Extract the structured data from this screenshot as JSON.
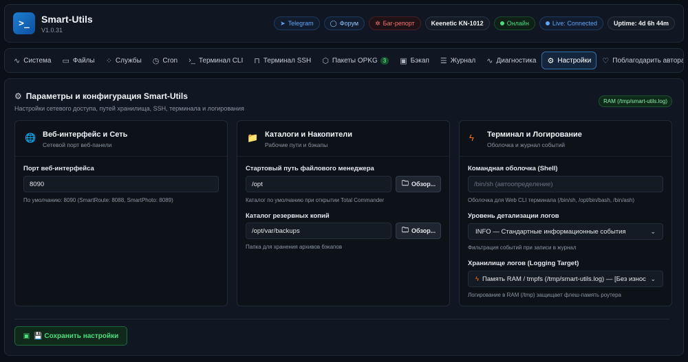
{
  "app": {
    "logo": ">_",
    "title": "Smart-Utils",
    "version": "V1.0.31"
  },
  "header_badges": {
    "telegram": "Telegram",
    "forum": "Форум",
    "bug": "Баг-репорт",
    "device": "Keenetic KN-1012",
    "online": "Онлайн",
    "live": "Live: Connected",
    "uptime": "Uptime: 4d 6h 44m"
  },
  "tabs": [
    {
      "label": "Система",
      "icon": "pulse-icon"
    },
    {
      "label": "Файлы",
      "icon": "folder-icon"
    },
    {
      "label": "Службы",
      "icon": "spinner-icon"
    },
    {
      "label": "Cron",
      "icon": "clock-icon"
    },
    {
      "label": "Терминал CLI",
      "icon": "terminal-icon"
    },
    {
      "label": "Терминал SSH",
      "icon": "lock-icon"
    },
    {
      "label": "Пакеты OPKG",
      "icon": "package-icon",
      "count": "3"
    },
    {
      "label": "Бэкап",
      "icon": "save-icon"
    },
    {
      "label": "Журнал",
      "icon": "list-icon"
    },
    {
      "label": "Диагностика",
      "icon": "pulse-icon"
    },
    {
      "label": "Настройки",
      "icon": "gear-icon",
      "active": true
    },
    {
      "label": "Поблагодарить автора",
      "icon": "heart-icon"
    }
  ],
  "page": {
    "title": "Параметры и конфигурация Smart-Utils",
    "subtitle": "Настройки сетевого доступа, путей хранилища, SSH, терминала и логирования",
    "ram_badge": "RAM (/tmp/smart-utils.log)"
  },
  "web_card": {
    "title": "Веб-интерфейс и Сеть",
    "subtitle": "Сетевой порт веб-панели",
    "port_label": "Порт веб-интерфейса",
    "port_value": "8090",
    "port_hint": "По умолчанию: 8090 (SmartRoute: 8088, SmartPhoto: 8089)"
  },
  "storage_card": {
    "title": "Каталоги и Накопители",
    "subtitle": "Рабочие пути и бэкапы",
    "fm_label": "Стартовый путь файлового менеджера",
    "fm_value": "/opt",
    "fm_hint": "Каталог по умолчанию при открытии Total Commander",
    "browse_label": "Обзор...",
    "backup_label": "Каталог резервных копий",
    "backup_value": "/opt/var/backups",
    "backup_hint": "Папка для хранения архивов бэкапов"
  },
  "term_card": {
    "title": "Терминал и Логирование",
    "subtitle": "Оболочка и журнал событий",
    "shell_label": "Командная оболочка (Shell)",
    "shell_placeholder": "/bin/sh (автоопределение)",
    "shell_hint": "Оболочка для Web CLI терминала (/bin/sh, /opt/bin/bash, /bin/ash)",
    "level_label": "Уровень детализации логов",
    "level_value": "INFO — Стандартные информационные события",
    "level_hint": "Фильтрация событий при записи в журнал",
    "target_label": "Хранилище логов (Logging Target)",
    "target_value": "Память RAM / tmpfs (/tmp/smart-utils.log) — [Без износа флеш-памяти]",
    "target_hint": "Логирование в RAM (/tmp) защищает флеш-память роутера"
  },
  "save_label": "💾 Сохранить настройки",
  "colors": {
    "accent": "#2f6fb0",
    "success": "#4ade80",
    "danger": "#f87171",
    "bg": "#0b0f17"
  }
}
